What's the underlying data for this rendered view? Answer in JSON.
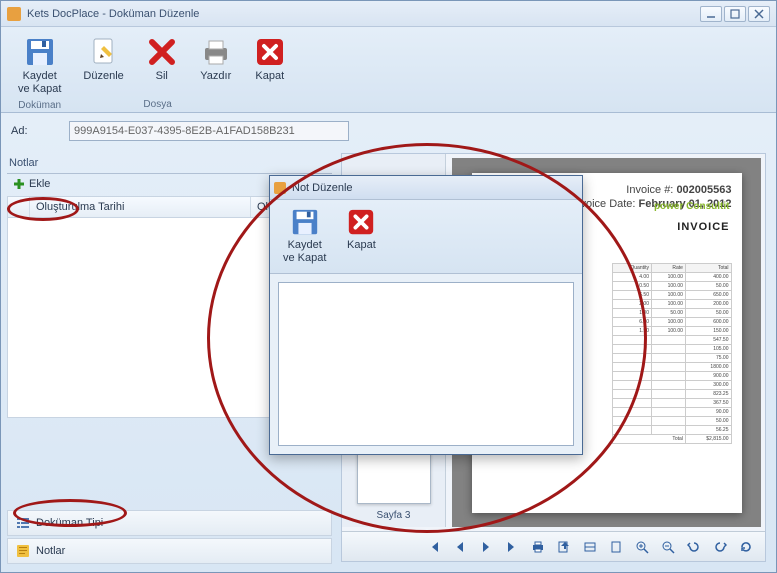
{
  "window": {
    "title": "Kets DocPlace - Doküman Düzenle"
  },
  "ribbon": {
    "group_document_label": "Doküman",
    "group_file_label": "Dosya",
    "save_close_label": "Kaydet\nve Kapat",
    "edit_label": "Düzenle",
    "delete_label": "Sil",
    "print_label": "Yazdır",
    "close_label": "Kapat"
  },
  "name_field": {
    "label": "Ad:",
    "value": "999A9154-E037-4395-8E2B-A1FAD158B231"
  },
  "notes_panel": {
    "header": "Notlar",
    "add_label": "Ekle",
    "col_created_date": "Oluşturulma Tarihi",
    "col_created_by": "Oluşturan K"
  },
  "tabs": {
    "doc_type": "Doküman Tipi",
    "notes": "Notlar"
  },
  "preview": {
    "page_label": "Sayfa 3",
    "invoice_no_label": "Invoice #:",
    "invoice_no": "002005563",
    "invoice_date_label": "Invoice Date:",
    "invoice_date": "February 01, 2012",
    "logo": "power Consultit",
    "invoice_title": "INVOICE",
    "col_qty": "Quantity",
    "col_rate": "Rate",
    "col_total": "Total",
    "total_label": "Total",
    "grand_total": "$2,815.00"
  },
  "dialog": {
    "title": "Not Düzenle",
    "save_close_label": "Kaydet\nve Kapat",
    "close_label": "Kapat",
    "text": ""
  },
  "chart_data": {
    "type": "table",
    "columns": [
      "Quantity",
      "Rate",
      "Total"
    ],
    "rows": [
      [
        4.0,
        100.0,
        400.0
      ],
      [
        0.5,
        100.0,
        50.0
      ],
      [
        6.5,
        100.0,
        650.0
      ],
      [
        2.0,
        100.0,
        200.0
      ],
      [
        1.0,
        50.0,
        50.0
      ],
      [
        6.0,
        100.0,
        600.0
      ],
      [
        1.5,
        100.0,
        150.0
      ],
      [
        null,
        null,
        547.5
      ],
      [
        null,
        null,
        105.0
      ],
      [
        null,
        null,
        75.0
      ],
      [
        null,
        null,
        1800.0
      ],
      [
        null,
        null,
        900.0
      ],
      [
        null,
        null,
        300.0
      ],
      [
        null,
        null,
        823.25
      ],
      [
        null,
        null,
        367.5
      ],
      [
        null,
        null,
        90.0
      ],
      [
        null,
        null,
        50.0
      ],
      [
        null,
        null,
        56.25
      ]
    ],
    "total": 2815.0
  }
}
